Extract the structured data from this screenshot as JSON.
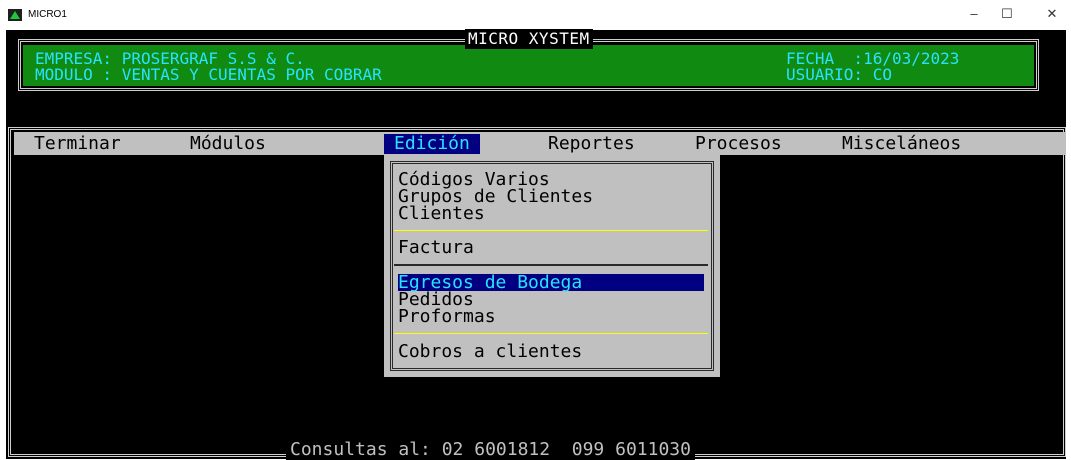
{
  "window": {
    "title": "MICRO1",
    "controls": {
      "minimize": "–",
      "maximize": "☐",
      "close": "✕"
    }
  },
  "header": {
    "system_title": "MICRO XYSTEM",
    "empresa_line": "EMPRESA: PROSERGRAF S.S & C.",
    "modulo_line": "MODULO : VENTAS Y CUENTAS POR COBRAR",
    "fecha_line": "FECHA  :16/03/2023",
    "usuario_line": "USUARIO: CO"
  },
  "menubar": {
    "items": [
      "Terminar",
      "Módulos",
      "Edición",
      "Reportes",
      "Procesos",
      "Misceláneos"
    ],
    "active": "Edición"
  },
  "dropdown": {
    "items": [
      "Códigos Varios",
      "Grupos de Clientes",
      "Clientes",
      "Factura",
      "Egresos de Bodega",
      "Pedidos",
      "Proformas",
      "Cobros a clientes"
    ],
    "selected": "Egresos de Bodega"
  },
  "footer": {
    "text": "Consultas al: 02 6001812  099 6011030"
  },
  "colors": {
    "background": "#000000",
    "header_green": "#108a10",
    "header_text": "#2ae2ff",
    "menu_gray": "#c0c0c0",
    "highlight": "#000080",
    "separator_yellow": "#ffff00"
  }
}
